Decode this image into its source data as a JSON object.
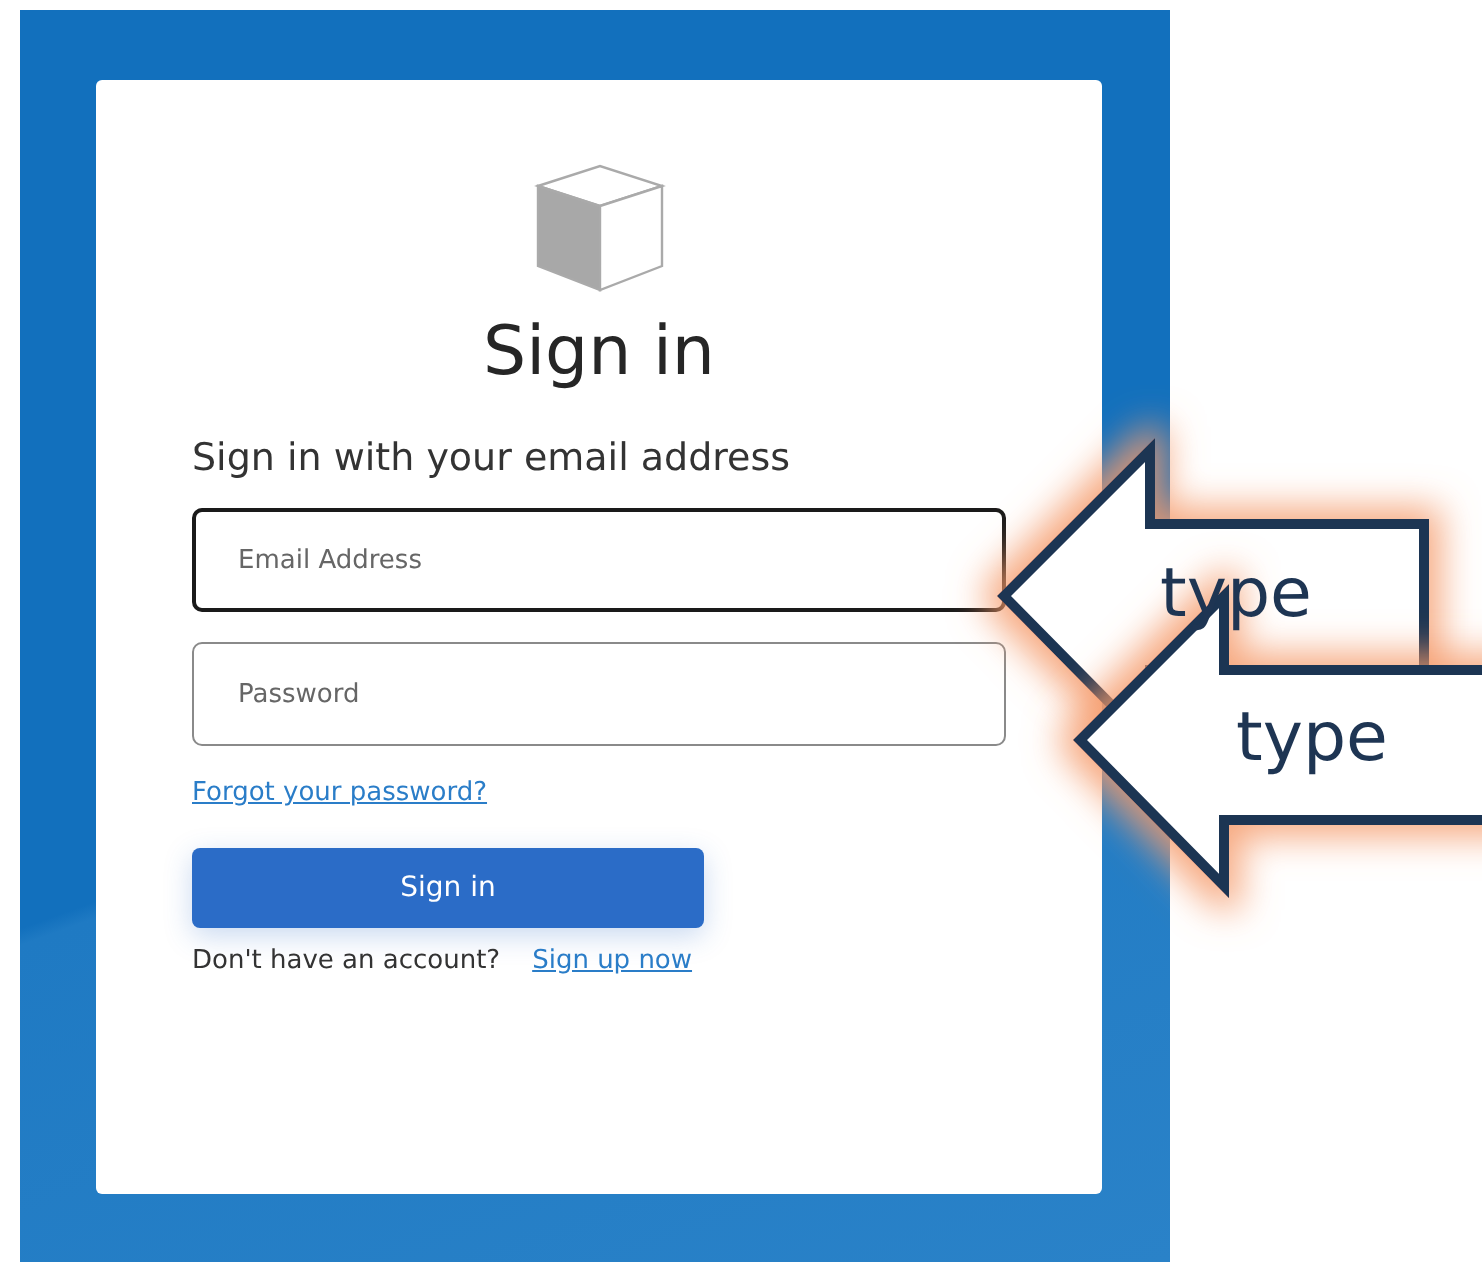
{
  "card": {
    "title": "Sign in",
    "subtitle": "Sign in with your email address"
  },
  "fields": [
    {
      "placeholder": "Email Address",
      "focused": true
    },
    {
      "placeholder": "Password",
      "focused": false
    }
  ],
  "forgot_link": "Forgot your password?",
  "submit_button": "Sign in",
  "signup": {
    "prompt": "Don't have an account?",
    "link": "Sign up now"
  },
  "annotations": [
    {
      "label": "type"
    },
    {
      "label": "type"
    }
  ]
}
